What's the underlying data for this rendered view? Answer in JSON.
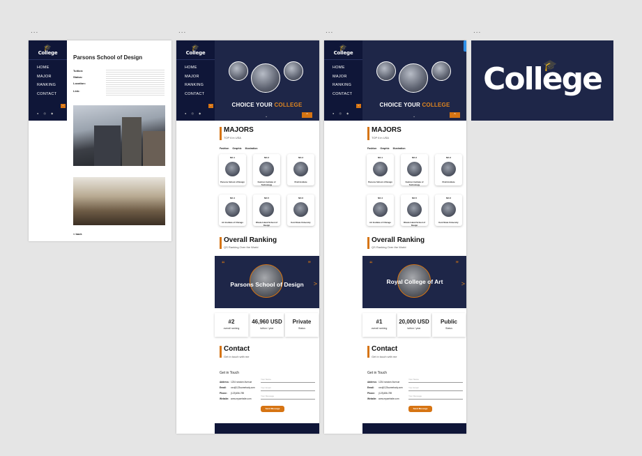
{
  "canvas_menu": "...",
  "brand": {
    "name": "College",
    "cap_icon": "graduation-cap-icon",
    "accent": "#d67413",
    "navy": "#1e2648",
    "dark_navy": "#0f1638"
  },
  "nav": [
    "HOME",
    "MAJOR",
    "RANKING",
    "CONTACT"
  ],
  "socials": [
    "facebook-icon",
    "instagram-icon",
    "twitter-icon"
  ],
  "detail_page": {
    "title": "Parsons School of Design",
    "fields": [
      "Tuition:",
      "Status:",
      "Location:",
      "Link:"
    ],
    "back": "< back"
  },
  "hero": {
    "text_main": "CHOICE YOUR",
    "text_accent": "COLLEGE",
    "chevron": "⌄",
    "up_button": "^"
  },
  "majors": {
    "title": "MAJORS",
    "subtitle": "TOP 6 in USA",
    "filters": "Fashion   Graphic   Illustration",
    "cards_a": [
      {
        "no": "NO.1",
        "name": "Parsons School of Design"
      },
      {
        "no": "NO.2",
        "name": "Fashion Institute of Technology"
      },
      {
        "no": "NO.3",
        "name": "Pratt Institute"
      },
      {
        "no": "NO.4",
        "name": "Art Institute of Chicago"
      },
      {
        "no": "NO.5",
        "name": "Rhode Island School of Design"
      },
      {
        "no": "NO.6",
        "name": "Kent State University"
      }
    ],
    "cards_b": [
      {
        "no": "NO.1",
        "name": "Parsons School of Design"
      },
      {
        "no": "NO.2",
        "name": "Fashion Institute of Technology"
      },
      {
        "no": "NO.3",
        "name": "Pratt Institute"
      },
      {
        "no": "NO.4",
        "name": "Art Institute of Chicago"
      },
      {
        "no": "NO.5",
        "name": "Rhode Island School of Design"
      },
      {
        "no": "NO.6",
        "name": "Kent State University"
      }
    ]
  },
  "ranking": {
    "title": "Overall Ranking",
    "subtitle": "QS Ranking Over the World",
    "quote_open": "“",
    "quote_close": "”",
    "next": ">",
    "a": {
      "name": "Parsons School of Design",
      "rank": "#2",
      "rank_label": "overall ranking",
      "tuition": "46,960 USD",
      "tuition_label": "tuition / year",
      "status": "Private",
      "status_label": "Status"
    },
    "b": {
      "name": "Royal College of Art",
      "rank": "#1",
      "rank_label": "overall ranking",
      "tuition": "20,000 USD",
      "tuition_label": "tuition / year",
      "status": "Public",
      "status_label": "Status"
    }
  },
  "contact": {
    "title": "Contact",
    "subtitle_a": "Get in touch with me",
    "subtitle_b": "Get in touch with me",
    "get_in_touch": "Get in Touch",
    "labels": [
      "Address:",
      "Email:",
      "Phone:",
      "Website:"
    ],
    "values": [
      "1234 random Avenue",
      "xxx@123somebody.com",
      "(123)456-789",
      "www.mywebsite.com"
    ],
    "placeholders": [
      "Your Name",
      "Your Email",
      "Your Message"
    ],
    "send": "Send Message"
  }
}
